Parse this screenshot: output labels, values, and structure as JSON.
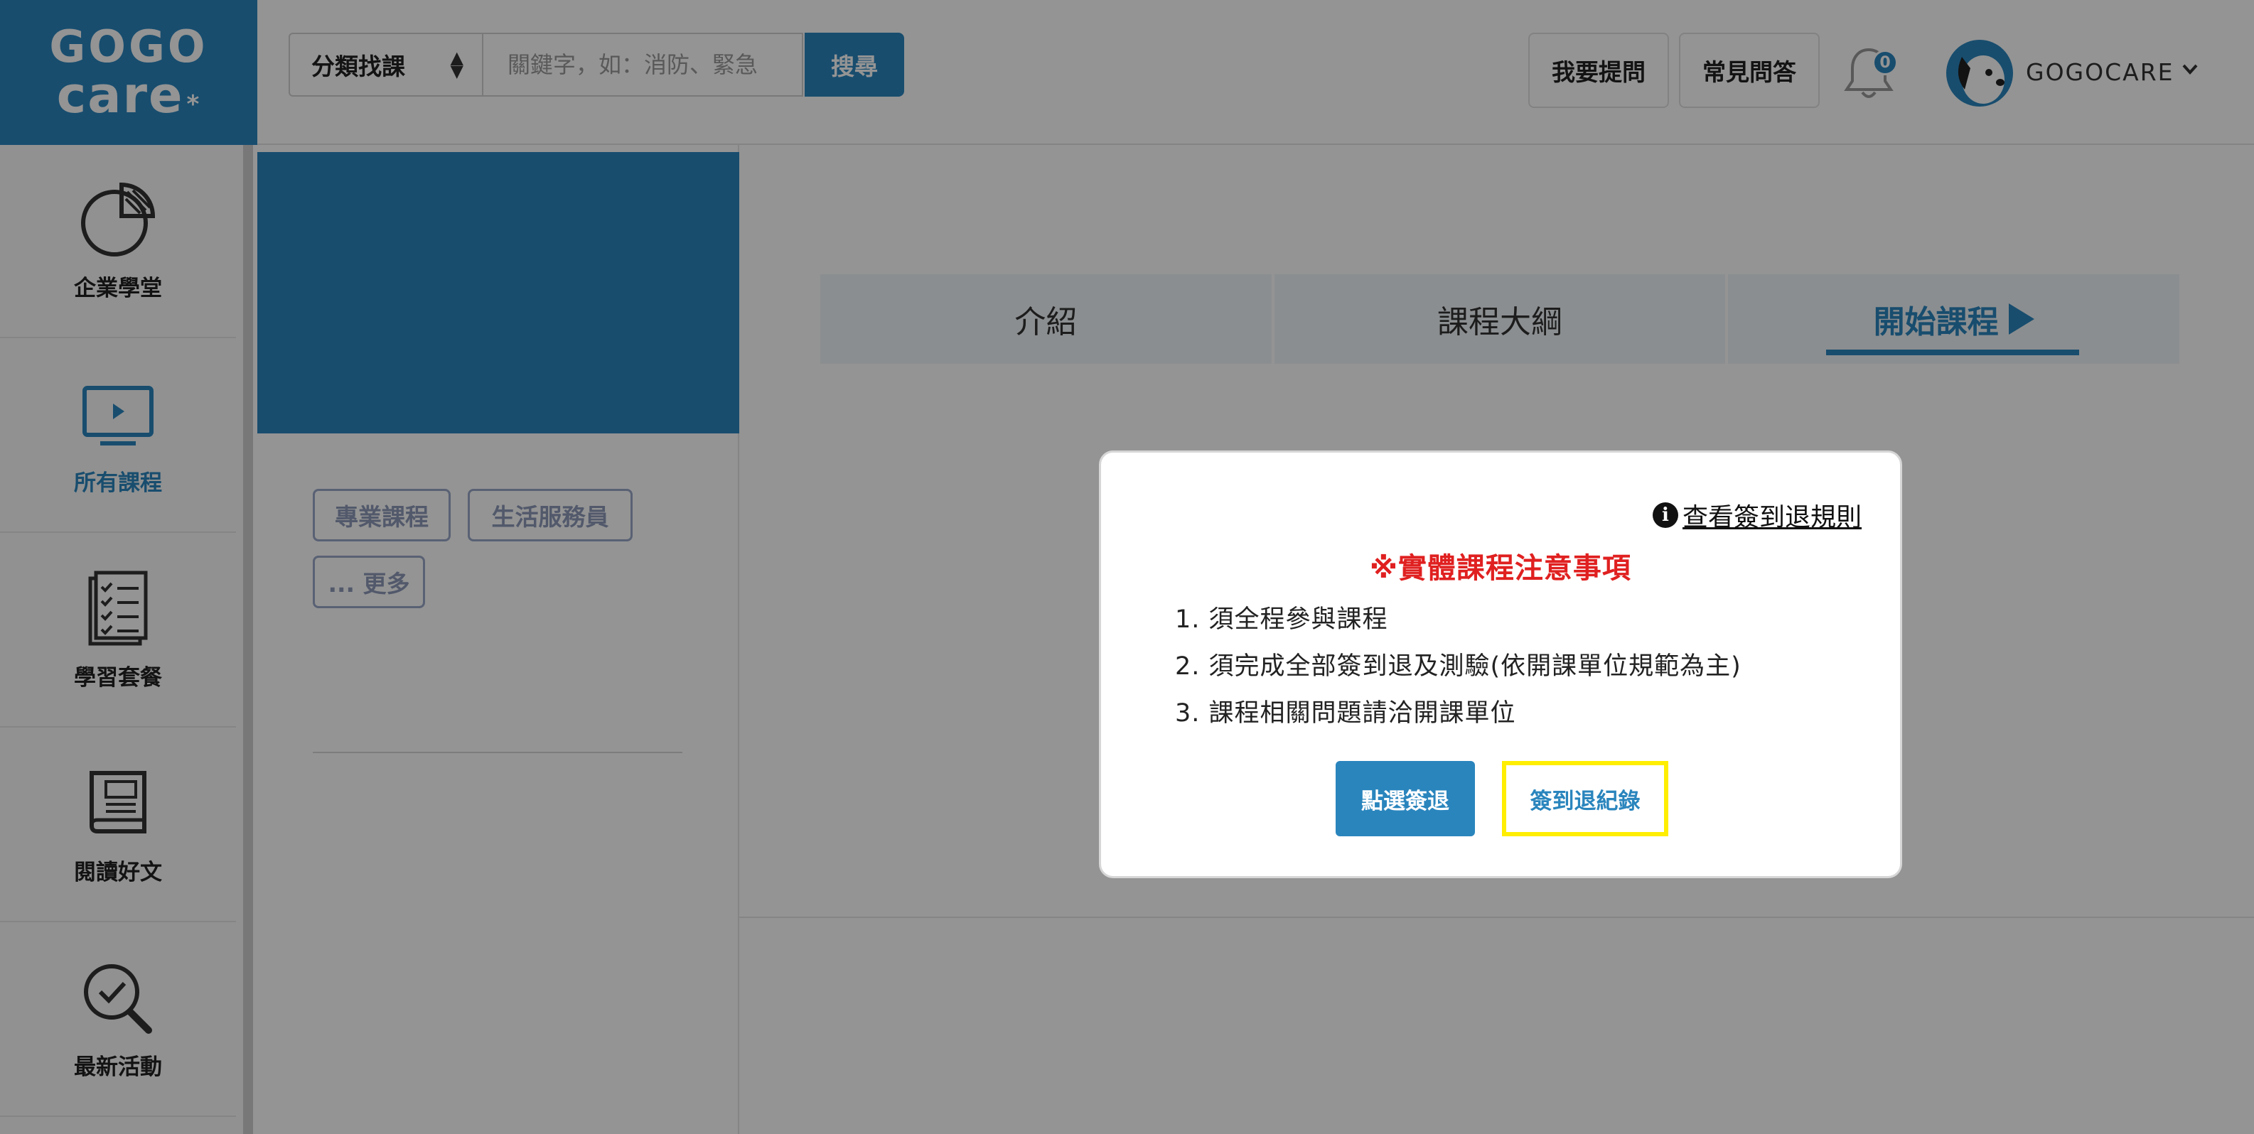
{
  "brand": {
    "line1": "GOGO",
    "line2": "care",
    "mark": "*",
    "color": "#2a85bd"
  },
  "header": {
    "category_select": "分類找課",
    "search_placeholder": "關鍵字，如：消防、緊急",
    "search_button": "搜尋",
    "ask_button": "我要提問",
    "faq_button": "常見問答",
    "notification_count": "0",
    "username": "GOGOCARE"
  },
  "sidebar": {
    "items": [
      {
        "label": "企業學堂",
        "icon": "pie-chart-icon"
      },
      {
        "label": "所有課程",
        "icon": "tv-play-icon",
        "active": true
      },
      {
        "label": "學習套餐",
        "icon": "checklist-icon"
      },
      {
        "label": "閱讀好文",
        "icon": "book-icon"
      },
      {
        "label": "最新活動",
        "icon": "magnifier-check-icon"
      }
    ]
  },
  "course": {
    "tags": [
      "專業課程",
      "生活服務員",
      "... 更多"
    ]
  },
  "tabs": [
    {
      "label": "介紹"
    },
    {
      "label": "課程大綱"
    },
    {
      "label": "開始課程",
      "active": true
    }
  ],
  "notice": {
    "rules_link": "查看簽到退規則",
    "title": "※實體課程注意事項",
    "items": [
      "1. 須全程參與課程",
      "2. 須完成全部簽到退及測驗(依開課單位規範為主)",
      "3. 課程相關問題請洽開課單位"
    ],
    "checkin_button": "點選簽退",
    "record_button": "簽到退紀錄",
    "title_color": "#e02020",
    "highlight_color": "#ffee00"
  }
}
